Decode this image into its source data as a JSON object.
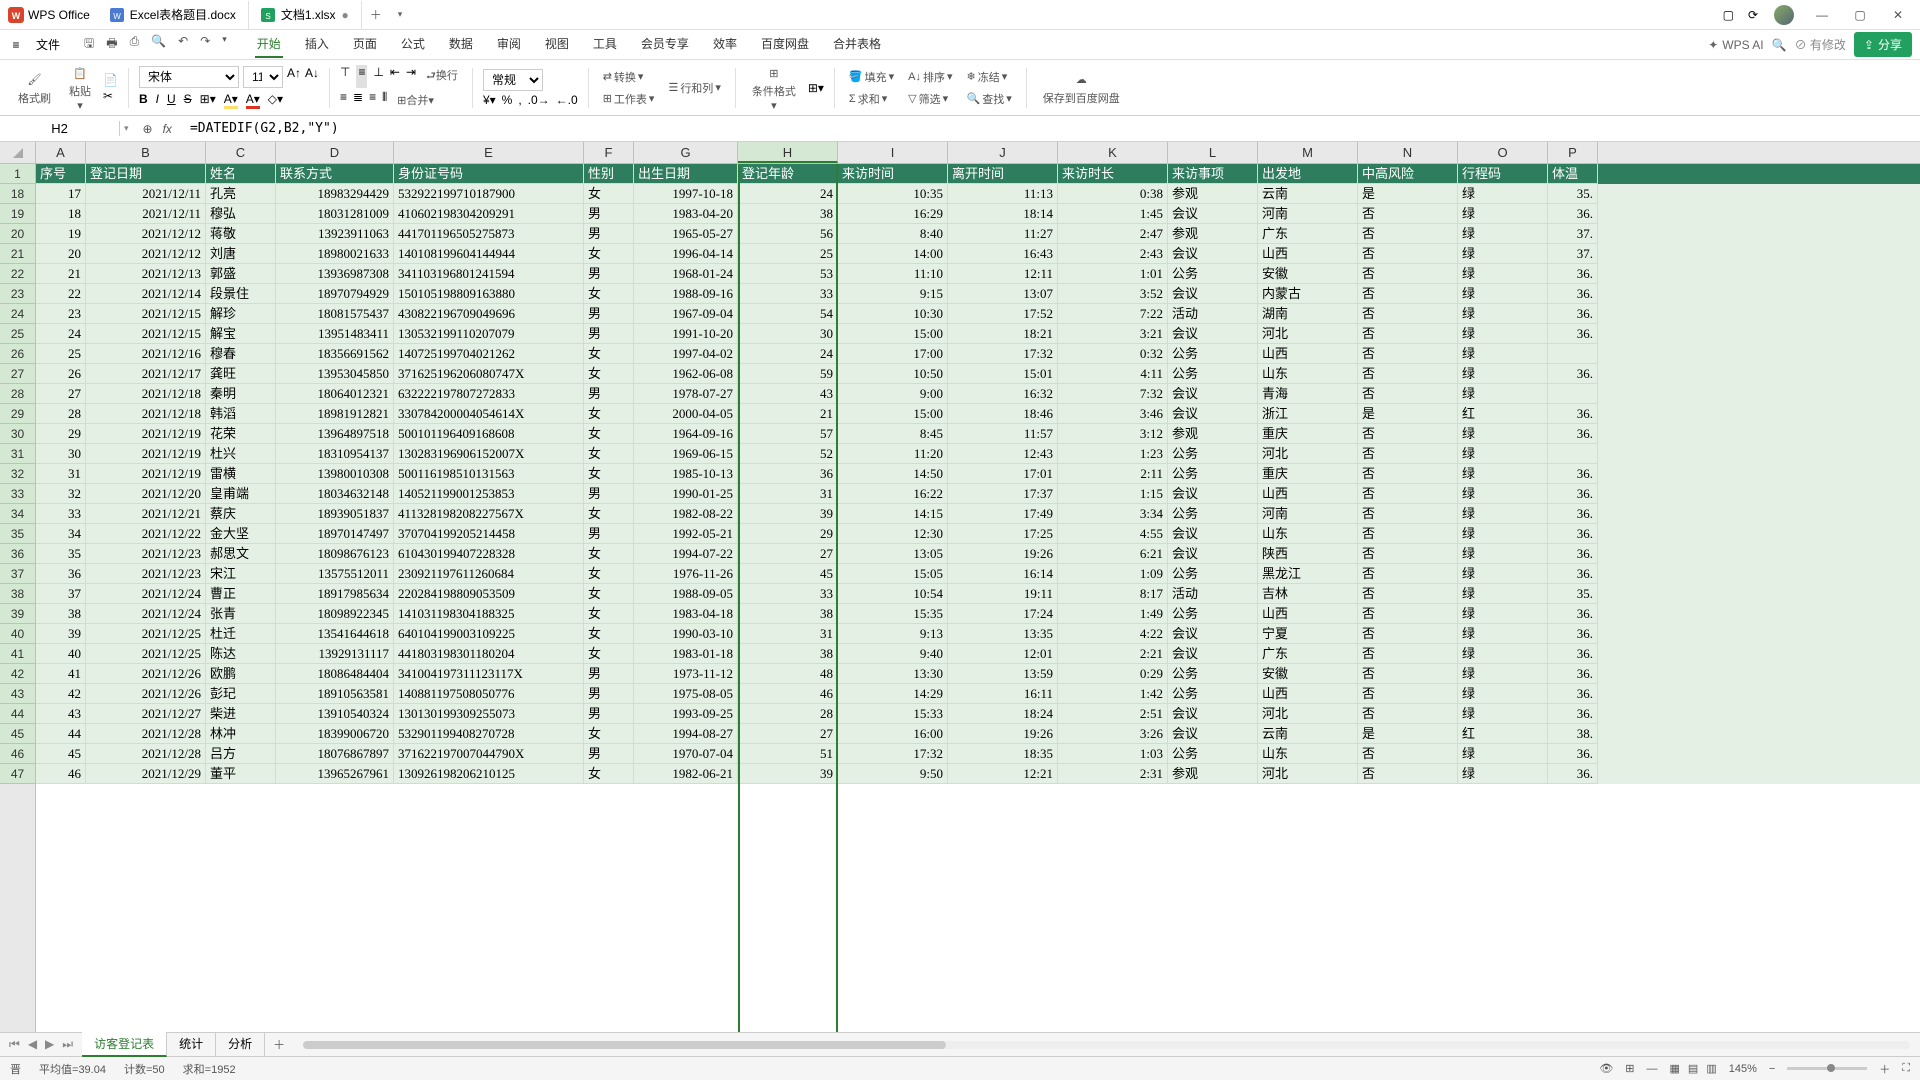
{
  "titlebar": {
    "app_name": "WPS Office",
    "tabs": [
      {
        "label": "Excel表格题目.docx",
        "type": "doc"
      },
      {
        "label": "文档1.xlsx",
        "type": "sheet",
        "modified": "●"
      }
    ]
  },
  "menubar": {
    "file": "文件",
    "items": [
      "开始",
      "插入",
      "页面",
      "公式",
      "数据",
      "审阅",
      "视图",
      "工具",
      "会员专享",
      "效率",
      "百度网盘",
      "合并表格"
    ],
    "active": "开始",
    "ai": "WPS AI",
    "unsynced": "有修改",
    "share": "分享"
  },
  "toolbar": {
    "format_brush": "格式刷",
    "paste": "粘贴",
    "font": "宋体",
    "size": "11",
    "normal": "常规",
    "transpose": "转换",
    "row_col": "行和列",
    "worksheet": "工作表",
    "condfmt": "条件格式",
    "fill": "填充",
    "sort": "排序",
    "freeze": "冻结",
    "sum": "求和",
    "filter": "筛选",
    "find": "查找",
    "save_cloud": "保存到百度网盘"
  },
  "formula_bar": {
    "name": "H2",
    "formula": "=DATEDIF(G2,B2,\"Y\")"
  },
  "columns": [
    "A",
    "B",
    "C",
    "D",
    "E",
    "F",
    "G",
    "H",
    "I",
    "J",
    "K",
    "L",
    "M",
    "N",
    "O",
    "P"
  ],
  "header_row_num": "1",
  "headers": [
    "序号",
    "登记日期",
    "姓名",
    "联系方式",
    "身份证号码",
    "性别",
    "出生日期",
    "登记年龄",
    "来访时间",
    "离开时间",
    "来访时长",
    "来访事项",
    "出发地",
    "中高风险",
    "行程码",
    "体温"
  ],
  "first_row_index": 18,
  "selected_col": "H",
  "rows": [
    {
      "n": 17,
      "d": "2021/12/11",
      "nm": "孔亮",
      "ph": "18983294429",
      "id": "532922199710187900",
      "sx": "女",
      "bd": "1997-10-18",
      "age": 24,
      "in": "10:35",
      "out": "11:13",
      "dur": "0:38",
      "pur": "参观",
      "from": "云南",
      "risk": "是",
      "code": "绿",
      "t": "35."
    },
    {
      "n": 18,
      "d": "2021/12/11",
      "nm": "穆弘",
      "ph": "18031281009",
      "id": "410602198304209291",
      "sx": "男",
      "bd": "1983-04-20",
      "age": 38,
      "in": "16:29",
      "out": "18:14",
      "dur": "1:45",
      "pur": "会议",
      "from": "河南",
      "risk": "否",
      "code": "绿",
      "t": "36."
    },
    {
      "n": 19,
      "d": "2021/12/12",
      "nm": "蒋敬",
      "ph": "13923911063",
      "id": "441701196505275873",
      "sx": "男",
      "bd": "1965-05-27",
      "age": 56,
      "in": "8:40",
      "out": "11:27",
      "dur": "2:47",
      "pur": "参观",
      "from": "广东",
      "risk": "否",
      "code": "绿",
      "t": "37."
    },
    {
      "n": 20,
      "d": "2021/12/12",
      "nm": "刘唐",
      "ph": "18980021633",
      "id": "140108199604144944",
      "sx": "女",
      "bd": "1996-04-14",
      "age": 25,
      "in": "14:00",
      "out": "16:43",
      "dur": "2:43",
      "pur": "会议",
      "from": "山西",
      "risk": "否",
      "code": "绿",
      "t": "37."
    },
    {
      "n": 21,
      "d": "2021/12/13",
      "nm": "郭盛",
      "ph": "13936987308",
      "id": "341103196801241594",
      "sx": "男",
      "bd": "1968-01-24",
      "age": 53,
      "in": "11:10",
      "out": "12:11",
      "dur": "1:01",
      "pur": "公务",
      "from": "安徽",
      "risk": "否",
      "code": "绿",
      "t": "36."
    },
    {
      "n": 22,
      "d": "2021/12/14",
      "nm": "段景住",
      "ph": "18970794929",
      "id": "150105198809163880",
      "sx": "女",
      "bd": "1988-09-16",
      "age": 33,
      "in": "9:15",
      "out": "13:07",
      "dur": "3:52",
      "pur": "会议",
      "from": "内蒙古",
      "risk": "否",
      "code": "绿",
      "t": "36."
    },
    {
      "n": 23,
      "d": "2021/12/15",
      "nm": "解珍",
      "ph": "18081575437",
      "id": "430822196709049696",
      "sx": "男",
      "bd": "1967-09-04",
      "age": 54,
      "in": "10:30",
      "out": "17:52",
      "dur": "7:22",
      "pur": "活动",
      "from": "湖南",
      "risk": "否",
      "code": "绿",
      "t": "36."
    },
    {
      "n": 24,
      "d": "2021/12/15",
      "nm": "解宝",
      "ph": "13951483411",
      "id": "130532199110207079",
      "sx": "男",
      "bd": "1991-10-20",
      "age": 30,
      "in": "15:00",
      "out": "18:21",
      "dur": "3:21",
      "pur": "会议",
      "from": "河北",
      "risk": "否",
      "code": "绿",
      "t": "36."
    },
    {
      "n": 25,
      "d": "2021/12/16",
      "nm": "穆春",
      "ph": "18356691562",
      "id": "140725199704021262",
      "sx": "女",
      "bd": "1997-04-02",
      "age": 24,
      "in": "17:00",
      "out": "17:32",
      "dur": "0:32",
      "pur": "公务",
      "from": "山西",
      "risk": "否",
      "code": "绿",
      "t": ""
    },
    {
      "n": 26,
      "d": "2021/12/17",
      "nm": "龚旺",
      "ph": "13953045850",
      "id": "371625196206080747X",
      "sx": "女",
      "bd": "1962-06-08",
      "age": 59,
      "in": "10:50",
      "out": "15:01",
      "dur": "4:11",
      "pur": "公务",
      "from": "山东",
      "risk": "否",
      "code": "绿",
      "t": "36."
    },
    {
      "n": 27,
      "d": "2021/12/18",
      "nm": "秦明",
      "ph": "18064012321",
      "id": "632222197807272833",
      "sx": "男",
      "bd": "1978-07-27",
      "age": 43,
      "in": "9:00",
      "out": "16:32",
      "dur": "7:32",
      "pur": "会议",
      "from": "青海",
      "risk": "否",
      "code": "绿",
      "t": ""
    },
    {
      "n": 28,
      "d": "2021/12/18",
      "nm": "韩滔",
      "ph": "18981912821",
      "id": "330784200004054614X",
      "sx": "女",
      "bd": "2000-04-05",
      "age": 21,
      "in": "15:00",
      "out": "18:46",
      "dur": "3:46",
      "pur": "会议",
      "from": "浙江",
      "risk": "是",
      "code": "红",
      "t": "36."
    },
    {
      "n": 29,
      "d": "2021/12/19",
      "nm": "花荣",
      "ph": "13964897518",
      "id": "500101196409168608",
      "sx": "女",
      "bd": "1964-09-16",
      "age": 57,
      "in": "8:45",
      "out": "11:57",
      "dur": "3:12",
      "pur": "参观",
      "from": "重庆",
      "risk": "否",
      "code": "绿",
      "t": "36."
    },
    {
      "n": 30,
      "d": "2021/12/19",
      "nm": "杜兴",
      "ph": "18310954137",
      "id": "130283196906152007X",
      "sx": "女",
      "bd": "1969-06-15",
      "age": 52,
      "in": "11:20",
      "out": "12:43",
      "dur": "1:23",
      "pur": "公务",
      "from": "河北",
      "risk": "否",
      "code": "绿",
      "t": ""
    },
    {
      "n": 31,
      "d": "2021/12/19",
      "nm": "雷横",
      "ph": "13980010308",
      "id": "500116198510131563",
      "sx": "女",
      "bd": "1985-10-13",
      "age": 36,
      "in": "14:50",
      "out": "17:01",
      "dur": "2:11",
      "pur": "公务",
      "from": "重庆",
      "risk": "否",
      "code": "绿",
      "t": "36."
    },
    {
      "n": 32,
      "d": "2021/12/20",
      "nm": "皇甫端",
      "ph": "18034632148",
      "id": "140521199001253853",
      "sx": "男",
      "bd": "1990-01-25",
      "age": 31,
      "in": "16:22",
      "out": "17:37",
      "dur": "1:15",
      "pur": "会议",
      "from": "山西",
      "risk": "否",
      "code": "绿",
      "t": "36."
    },
    {
      "n": 33,
      "d": "2021/12/21",
      "nm": "蔡庆",
      "ph": "18939051837",
      "id": "411328198208227567X",
      "sx": "女",
      "bd": "1982-08-22",
      "age": 39,
      "in": "14:15",
      "out": "17:49",
      "dur": "3:34",
      "pur": "公务",
      "from": "河南",
      "risk": "否",
      "code": "绿",
      "t": "36."
    },
    {
      "n": 34,
      "d": "2021/12/22",
      "nm": "金大坚",
      "ph": "18970147497",
      "id": "370704199205214458",
      "sx": "男",
      "bd": "1992-05-21",
      "age": 29,
      "in": "12:30",
      "out": "17:25",
      "dur": "4:55",
      "pur": "会议",
      "from": "山东",
      "risk": "否",
      "code": "绿",
      "t": "36."
    },
    {
      "n": 35,
      "d": "2021/12/23",
      "nm": "郝思文",
      "ph": "18098676123",
      "id": "610430199407228328",
      "sx": "女",
      "bd": "1994-07-22",
      "age": 27,
      "in": "13:05",
      "out": "19:26",
      "dur": "6:21",
      "pur": "会议",
      "from": "陕西",
      "risk": "否",
      "code": "绿",
      "t": "36."
    },
    {
      "n": 36,
      "d": "2021/12/23",
      "nm": "宋江",
      "ph": "13575512011",
      "id": "230921197611260684",
      "sx": "女",
      "bd": "1976-11-26",
      "age": 45,
      "in": "15:05",
      "out": "16:14",
      "dur": "1:09",
      "pur": "公务",
      "from": "黑龙江",
      "risk": "否",
      "code": "绿",
      "t": "36."
    },
    {
      "n": 37,
      "d": "2021/12/24",
      "nm": "曹正",
      "ph": "18917985634",
      "id": "220284198809053509",
      "sx": "女",
      "bd": "1988-09-05",
      "age": 33,
      "in": "10:54",
      "out": "19:11",
      "dur": "8:17",
      "pur": "活动",
      "from": "吉林",
      "risk": "否",
      "code": "绿",
      "t": "35."
    },
    {
      "n": 38,
      "d": "2021/12/24",
      "nm": "张青",
      "ph": "18098922345",
      "id": "141031198304188325",
      "sx": "女",
      "bd": "1983-04-18",
      "age": 38,
      "in": "15:35",
      "out": "17:24",
      "dur": "1:49",
      "pur": "公务",
      "from": "山西",
      "risk": "否",
      "code": "绿",
      "t": "36."
    },
    {
      "n": 39,
      "d": "2021/12/25",
      "nm": "杜迁",
      "ph": "13541644618",
      "id": "640104199003109225",
      "sx": "女",
      "bd": "1990-03-10",
      "age": 31,
      "in": "9:13",
      "out": "13:35",
      "dur": "4:22",
      "pur": "会议",
      "from": "宁夏",
      "risk": "否",
      "code": "绿",
      "t": "36."
    },
    {
      "n": 40,
      "d": "2021/12/25",
      "nm": "陈达",
      "ph": "13929131117",
      "id": "441803198301180204",
      "sx": "女",
      "bd": "1983-01-18",
      "age": 38,
      "in": "9:40",
      "out": "12:01",
      "dur": "2:21",
      "pur": "会议",
      "from": "广东",
      "risk": "否",
      "code": "绿",
      "t": "36."
    },
    {
      "n": 41,
      "d": "2021/12/26",
      "nm": "欧鹏",
      "ph": "18086484404",
      "id": "341004197311123117X",
      "sx": "男",
      "bd": "1973-11-12",
      "age": 48,
      "in": "13:30",
      "out": "13:59",
      "dur": "0:29",
      "pur": "公务",
      "from": "安徽",
      "risk": "否",
      "code": "绿",
      "t": "36."
    },
    {
      "n": 42,
      "d": "2021/12/26",
      "nm": "彭玘",
      "ph": "18910563581",
      "id": "140881197508050776",
      "sx": "男",
      "bd": "1975-08-05",
      "age": 46,
      "in": "14:29",
      "out": "16:11",
      "dur": "1:42",
      "pur": "公务",
      "from": "山西",
      "risk": "否",
      "code": "绿",
      "t": "36."
    },
    {
      "n": 43,
      "d": "2021/12/27",
      "nm": "柴进",
      "ph": "13910540324",
      "id": "130130199309255073",
      "sx": "男",
      "bd": "1993-09-25",
      "age": 28,
      "in": "15:33",
      "out": "18:24",
      "dur": "2:51",
      "pur": "会议",
      "from": "河北",
      "risk": "否",
      "code": "绿",
      "t": "36."
    },
    {
      "n": 44,
      "d": "2021/12/28",
      "nm": "林冲",
      "ph": "18399006720",
      "id": "532901199408270728",
      "sx": "女",
      "bd": "1994-08-27",
      "age": 27,
      "in": "16:00",
      "out": "19:26",
      "dur": "3:26",
      "pur": "会议",
      "from": "云南",
      "risk": "是",
      "code": "红",
      "t": "38."
    },
    {
      "n": 45,
      "d": "2021/12/28",
      "nm": "吕方",
      "ph": "18076867897",
      "id": "371622197007044790X",
      "sx": "男",
      "bd": "1970-07-04",
      "age": 51,
      "in": "17:32",
      "out": "18:35",
      "dur": "1:03",
      "pur": "公务",
      "from": "山东",
      "risk": "否",
      "code": "绿",
      "t": "36."
    },
    {
      "n": 46,
      "d": "2021/12/29",
      "nm": "董平",
      "ph": "13965267961",
      "id": "130926198206210125",
      "sx": "女",
      "bd": "1982-06-21",
      "age": 39,
      "in": "9:50",
      "out": "12:21",
      "dur": "2:31",
      "pur": "参观",
      "from": "河北",
      "risk": "否",
      "code": "绿",
      "t": "36."
    }
  ],
  "sheets": {
    "tabs": [
      "访客登记表",
      "统计",
      "分析"
    ],
    "active": "访客登记表"
  },
  "statusbar": {
    "mode": "晋",
    "avg_label": "平均值=",
    "avg": "39.04",
    "count_label": "计数=",
    "count": "50",
    "sum_label": "求和=",
    "sum": "1952",
    "zoom": "145%"
  }
}
